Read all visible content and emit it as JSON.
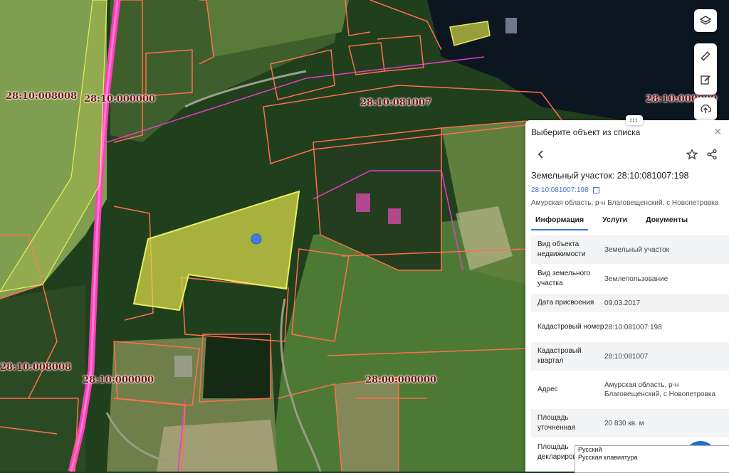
{
  "map": {
    "labels": [
      "28:10:008008",
      "28:10:000000",
      "28:10:081007",
      "28:10:000000",
      "28:10:008008",
      "28:10:000000",
      "28:00:000000"
    ],
    "colors": {
      "parcel_outline": "#ff6f4e",
      "selected_fill": "#d6d84a",
      "road": "#ff3fb8",
      "zone_line": "#e63cc8"
    }
  },
  "toolbar": {
    "icons": [
      "layers-icon",
      "ruler-icon",
      "edit-icon",
      "upload-icon"
    ]
  },
  "panel": {
    "header": "Выберите объект из списка",
    "title": "Земельный участок: 28:10:081007:198",
    "cadastral_link": "28:10:081007:198",
    "address_line": "Амурская область, р-н Благовещенский, с Новопетровка",
    "tabs": [
      {
        "label": "Информация",
        "active": true
      },
      {
        "label": "Услуги",
        "active": false
      },
      {
        "label": "Документы",
        "active": false
      }
    ],
    "rows": [
      {
        "key": "Вид объекта недвижимости",
        "value": "Земельный участок"
      },
      {
        "key": "Вид земельного участка",
        "value": "Землепользование"
      },
      {
        "key": "Дата присвоения",
        "value": "09.03.2017"
      },
      {
        "key": "Кадастровый номер",
        "value": "28:10:081007:198"
      },
      {
        "key": "Кадастровый квартал",
        "value": "28:10:081007"
      },
      {
        "key": "Адрес",
        "value": "Амурская область, р-н Благовещенский, с Новопетровка"
      },
      {
        "key": "Площадь уточненная",
        "value": "20 830 кв. м"
      },
      {
        "key": "Площадь декларированная",
        "value": ""
      }
    ]
  },
  "keyboard_tooltip": {
    "lang": "Русский",
    "layout": "Русская клавиатура"
  }
}
